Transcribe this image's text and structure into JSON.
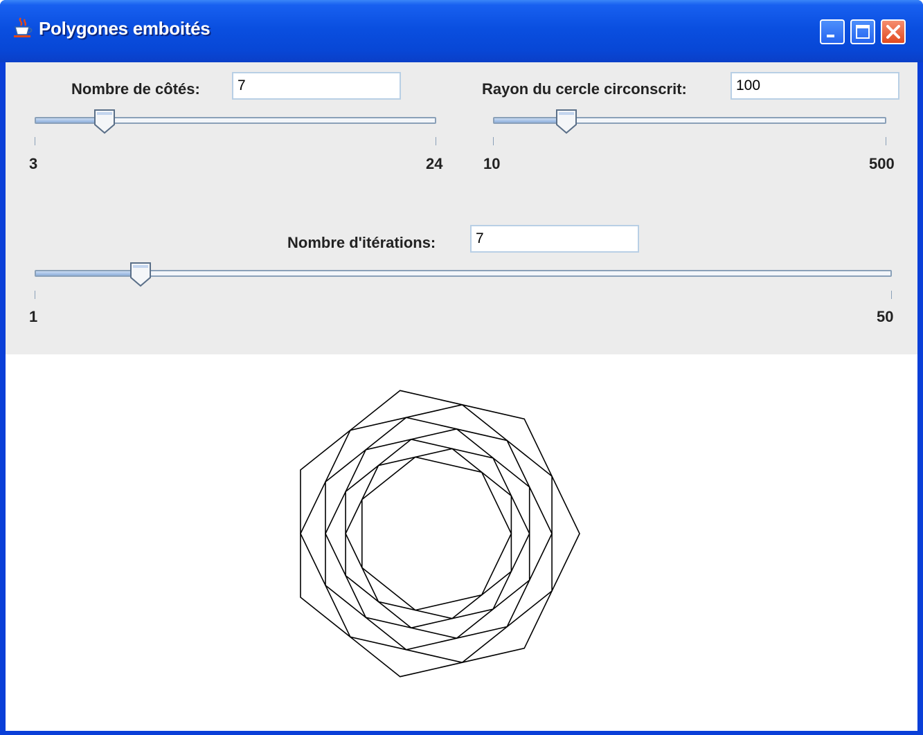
{
  "window": {
    "title": "Polygones emboités"
  },
  "sides": {
    "label": "Nombre de côtés:",
    "value": "7",
    "min_label": "3",
    "max_label": "24",
    "min": 3,
    "max": 24,
    "current": 7
  },
  "radius": {
    "label": "Rayon du cercle circonscrit:",
    "value": "100",
    "min_label": "10",
    "max_label": "500",
    "min": 10,
    "max": 500,
    "current": 100
  },
  "iterations": {
    "label": "Nombre d'itérations:",
    "value": "7",
    "min_label": "1",
    "max_label": "50",
    "min": 1,
    "max": 50,
    "current": 7
  },
  "colors": {
    "title_bar": "#0a4fe0",
    "panel": "#ececec",
    "canvas": "#ffffff",
    "polygon_stroke": "#000000"
  },
  "icons": [
    "java-cup-icon",
    "minimize-icon",
    "maximize-icon",
    "close-icon",
    "slider-thumb-icon"
  ]
}
